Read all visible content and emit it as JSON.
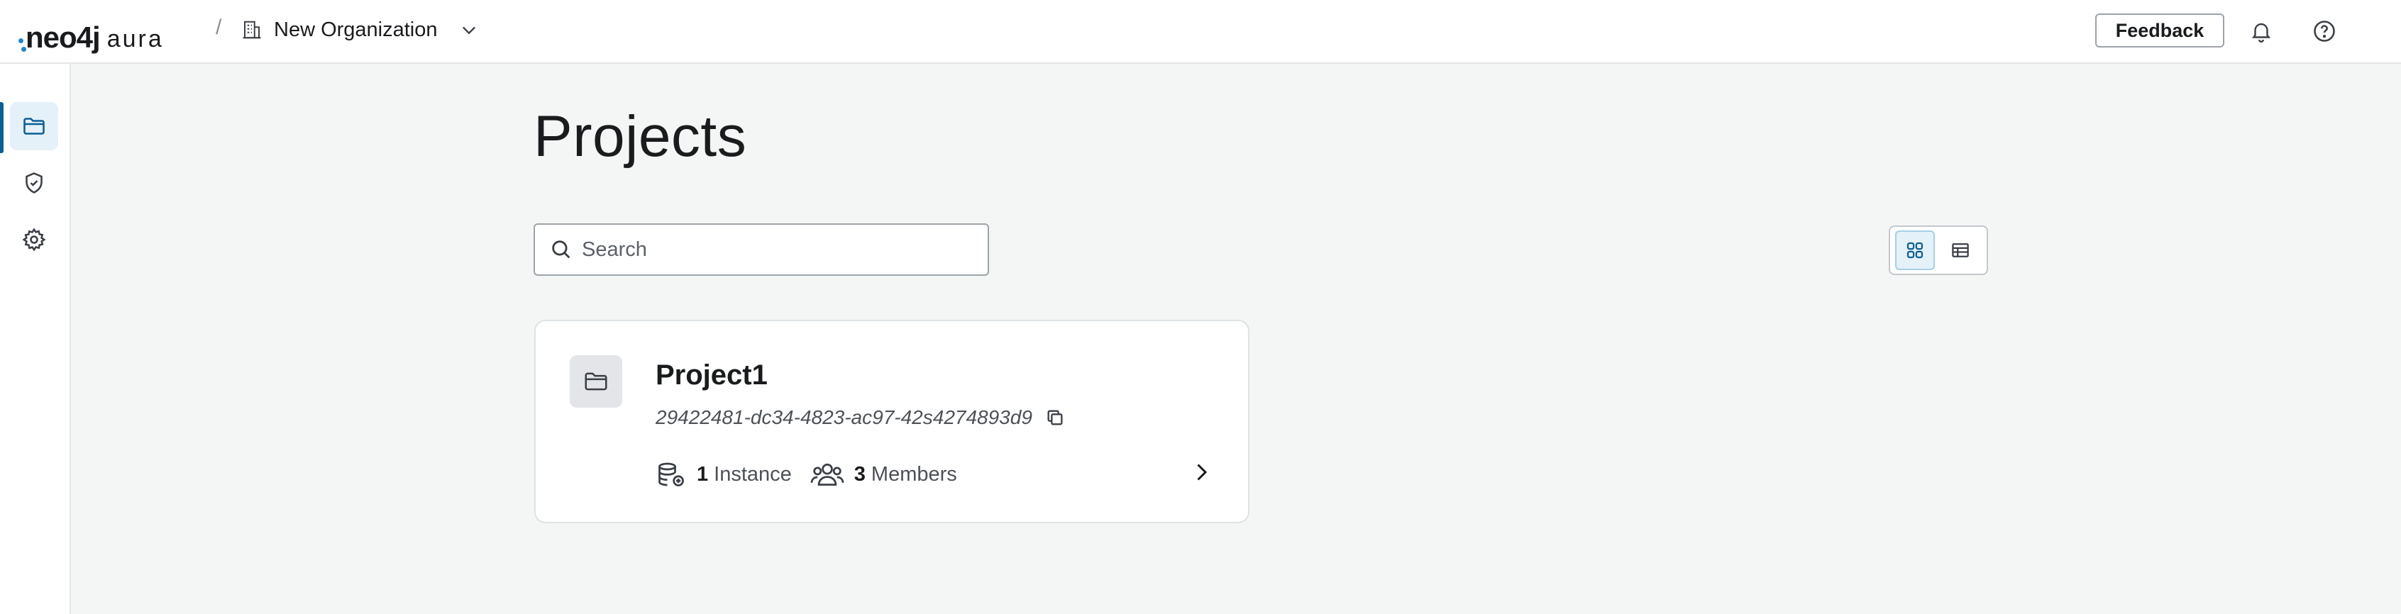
{
  "app": {
    "logo_wordmark": "neo4j",
    "logo_product": "aura"
  },
  "header": {
    "breadcrumb_separator": "/",
    "org_icon": "building-icon",
    "org_name": "New Organization",
    "feedback_label": "Feedback",
    "icons": [
      "bell-icon",
      "help-icon"
    ]
  },
  "sidebar": {
    "items": [
      {
        "name": "projects",
        "icon": "folder-icon",
        "active": true
      },
      {
        "name": "security",
        "icon": "shield-check-icon",
        "active": false
      },
      {
        "name": "settings",
        "icon": "gear-icon",
        "active": false
      }
    ]
  },
  "main": {
    "title": "Projects",
    "search_placeholder": "Search",
    "search_value": "",
    "view_modes": [
      {
        "name": "grid",
        "icon": "grid-icon",
        "active": true
      },
      {
        "name": "table",
        "icon": "table-icon",
        "active": false
      }
    ]
  },
  "projects": [
    {
      "name": "Project1",
      "id": "29422481-dc34-4823-ac97-42s4274893d9",
      "instances_count": "1",
      "instances_label": "Instance",
      "members_count": "3",
      "members_label": "Members"
    }
  ],
  "colors": {
    "accent": "#0a5f95",
    "accent_bg": "#e5f1f8",
    "page_bg": "#f4f6f5",
    "logo_dot": "#1e88c8"
  }
}
